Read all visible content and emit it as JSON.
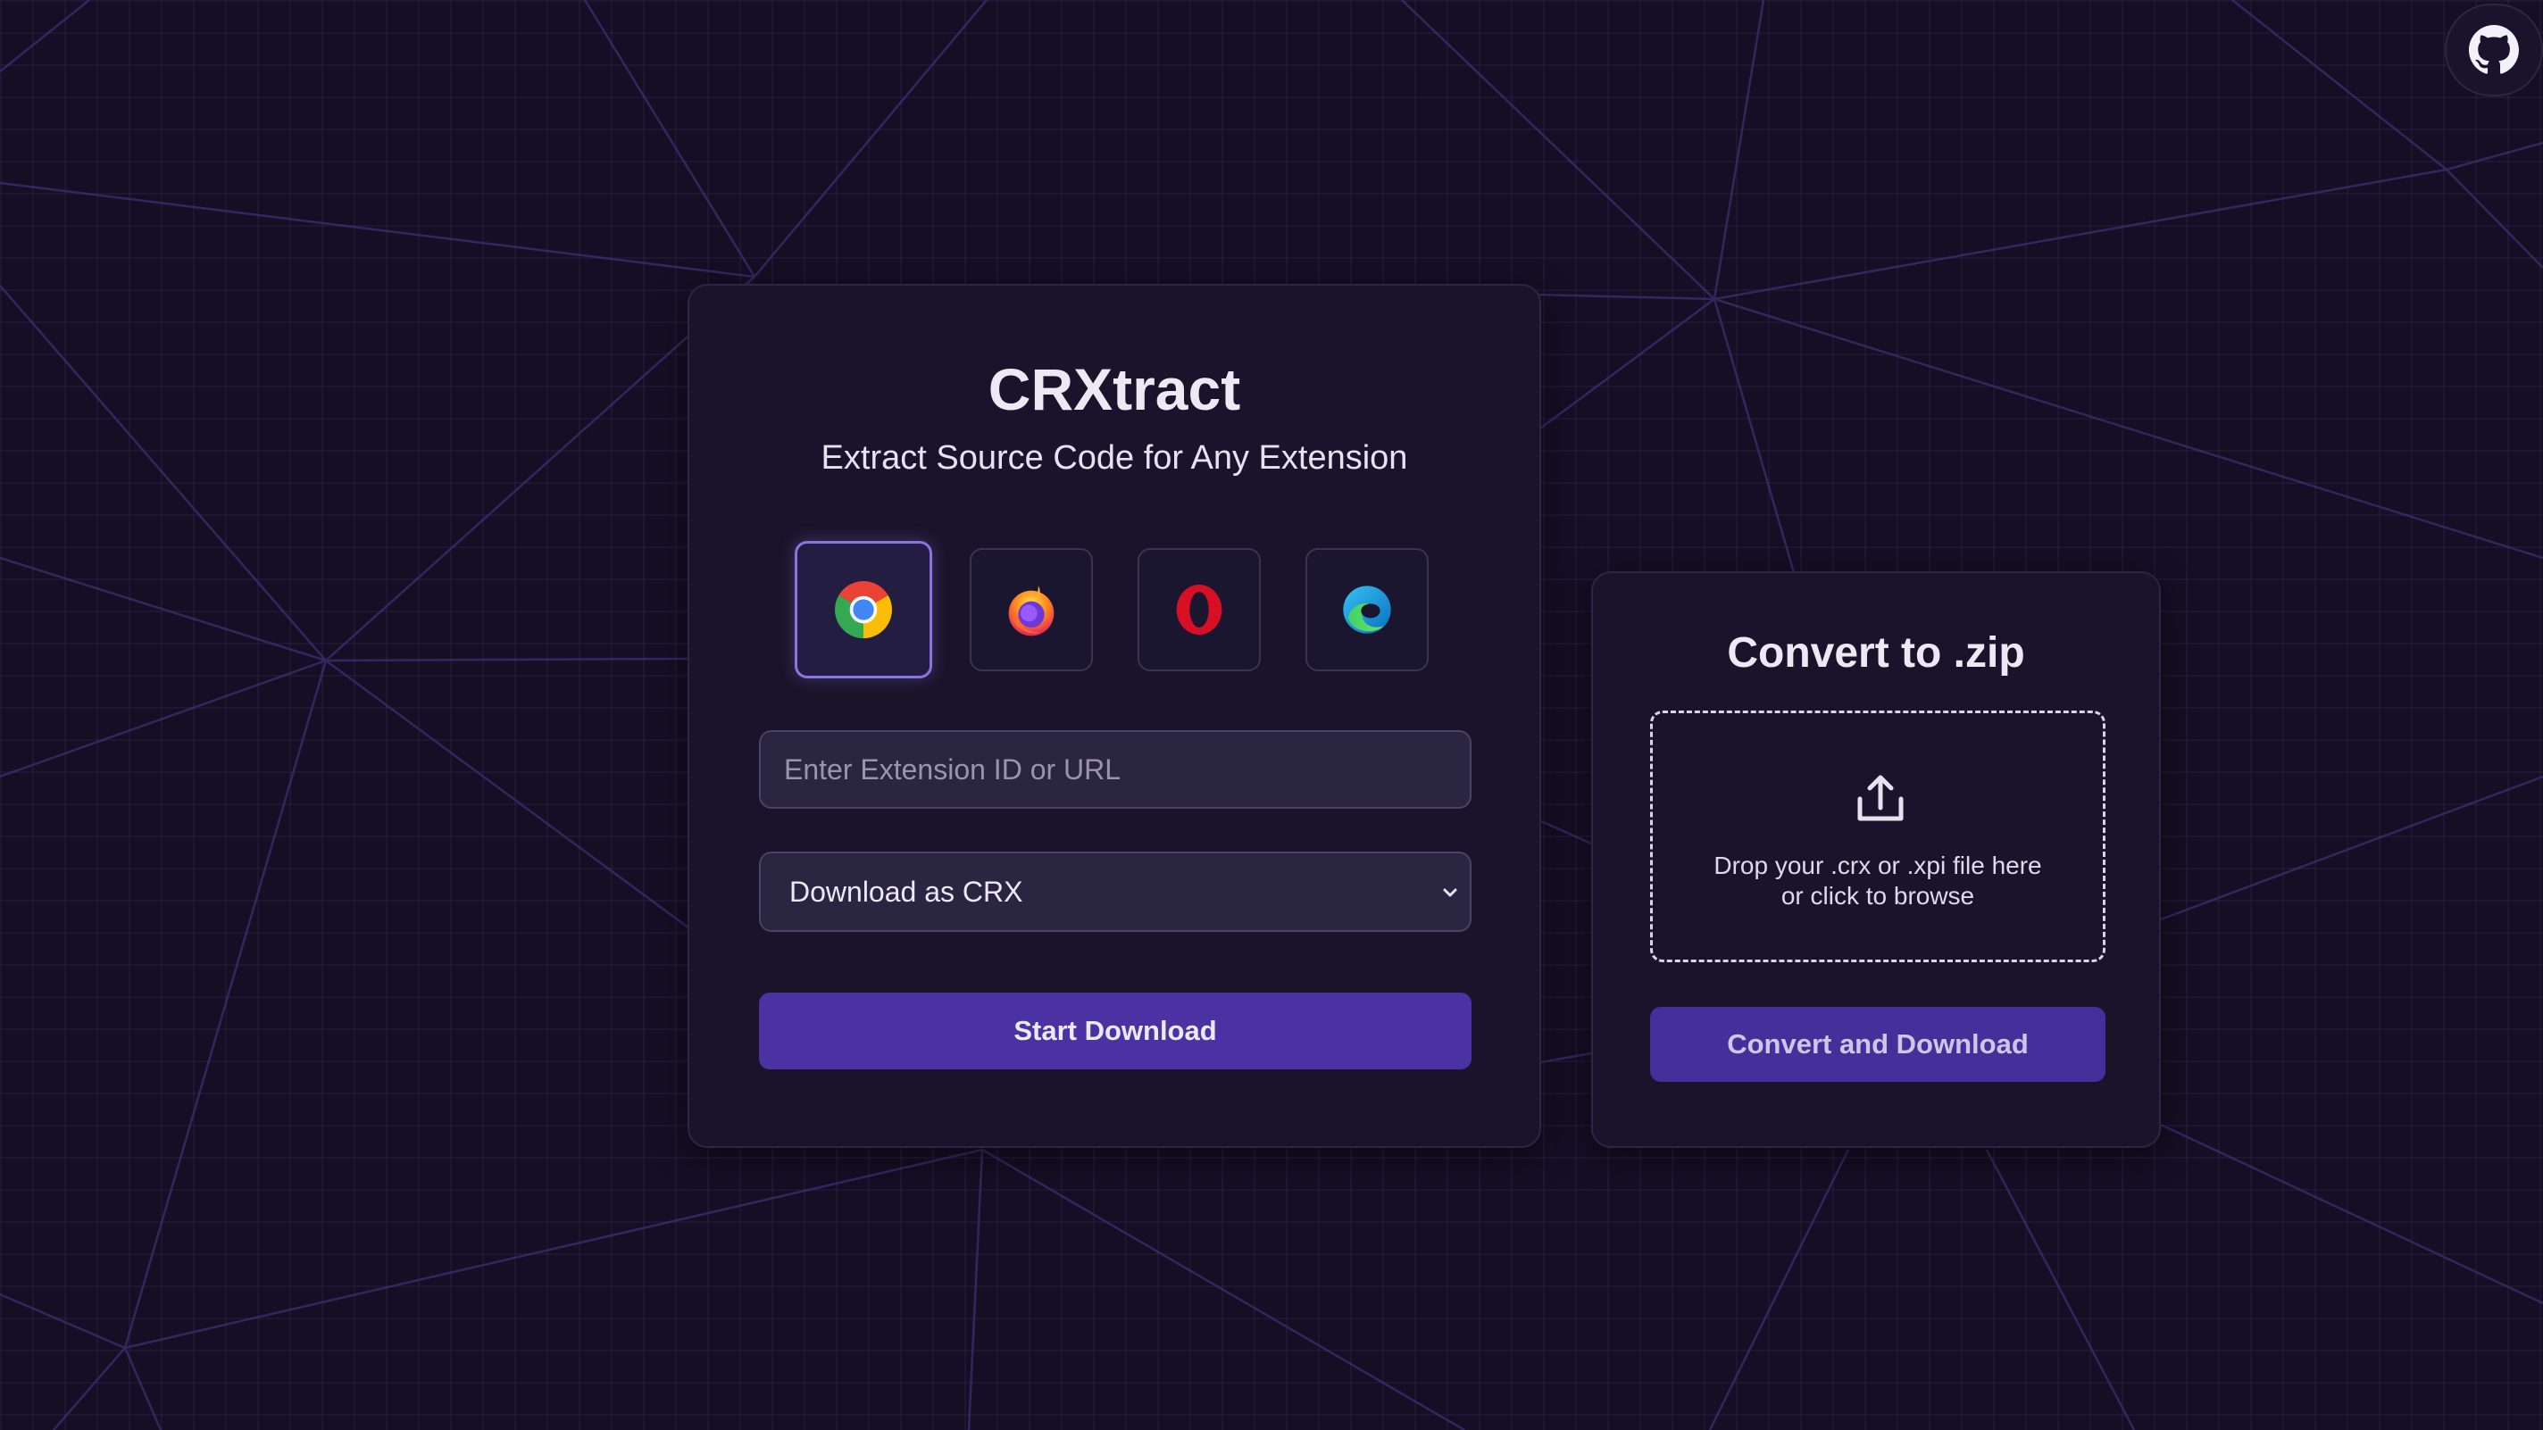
{
  "app": {
    "title": "CRXtract",
    "subtitle": "Extract Source Code for Any Extension"
  },
  "browsers": [
    {
      "name": "chrome",
      "icon": "chrome-icon",
      "selected": true
    },
    {
      "name": "firefox",
      "icon": "firefox-icon",
      "selected": false
    },
    {
      "name": "opera",
      "icon": "opera-icon",
      "selected": false
    },
    {
      "name": "edge",
      "icon": "edge-icon",
      "selected": false
    }
  ],
  "extension_input": {
    "value": "",
    "placeholder": "Enter Extension ID or URL"
  },
  "download_format": {
    "selected": "Download as CRX"
  },
  "start_button": {
    "label": "Start Download"
  },
  "convert": {
    "title": "Convert to .zip",
    "dropzone_text": "Drop your .crx or .xpi file here or click to browse",
    "button_label": "Convert and Download",
    "upload_icon": "upload-icon"
  },
  "github": {
    "icon": "github-icon"
  },
  "colors": {
    "background": "#140f24",
    "card": "#19142b",
    "accent": "#4a32a3",
    "selected_border": "#8b73e0"
  }
}
